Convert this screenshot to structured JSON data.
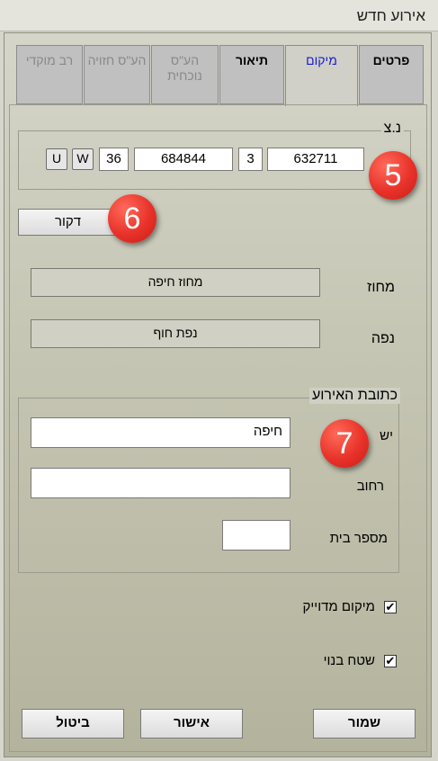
{
  "window": {
    "title": "אירוע חדש"
  },
  "tabs": [
    {
      "label": "פרטים"
    },
    {
      "label": "מיקום"
    },
    {
      "label": "תיאור"
    },
    {
      "label": "הע\"ס נוכחית"
    },
    {
      "label": "הע\"ס חזויה"
    },
    {
      "label": "רב מוקדי"
    }
  ],
  "coords": {
    "group_label": "נ.צ",
    "field1": "632711",
    "field2": "3",
    "field3": "684844",
    "field4": "36",
    "btn_w": "W",
    "btn_u": "U"
  },
  "decor_button": "דקור",
  "district": {
    "label": "מחוז",
    "value": "מחוז חיפה"
  },
  "region": {
    "label": "נפה",
    "value": "נפת חוף"
  },
  "address": {
    "group_label": "כתובת האירוע",
    "city_label": "יש",
    "city_value": "חיפה",
    "street_label": "רחוב",
    "street_value": "",
    "house_label": "מספר בית",
    "house_value": ""
  },
  "checkboxes": {
    "exact_location": {
      "label": "מיקום מדוייק",
      "checked": true
    },
    "built_area": {
      "label": "שטח בנוי",
      "checked": true
    }
  },
  "buttons": {
    "save": "שמור",
    "ok": "אישור",
    "cancel": "ביטול"
  },
  "badges": {
    "b5": "5",
    "b6": "6",
    "b7": "7"
  }
}
